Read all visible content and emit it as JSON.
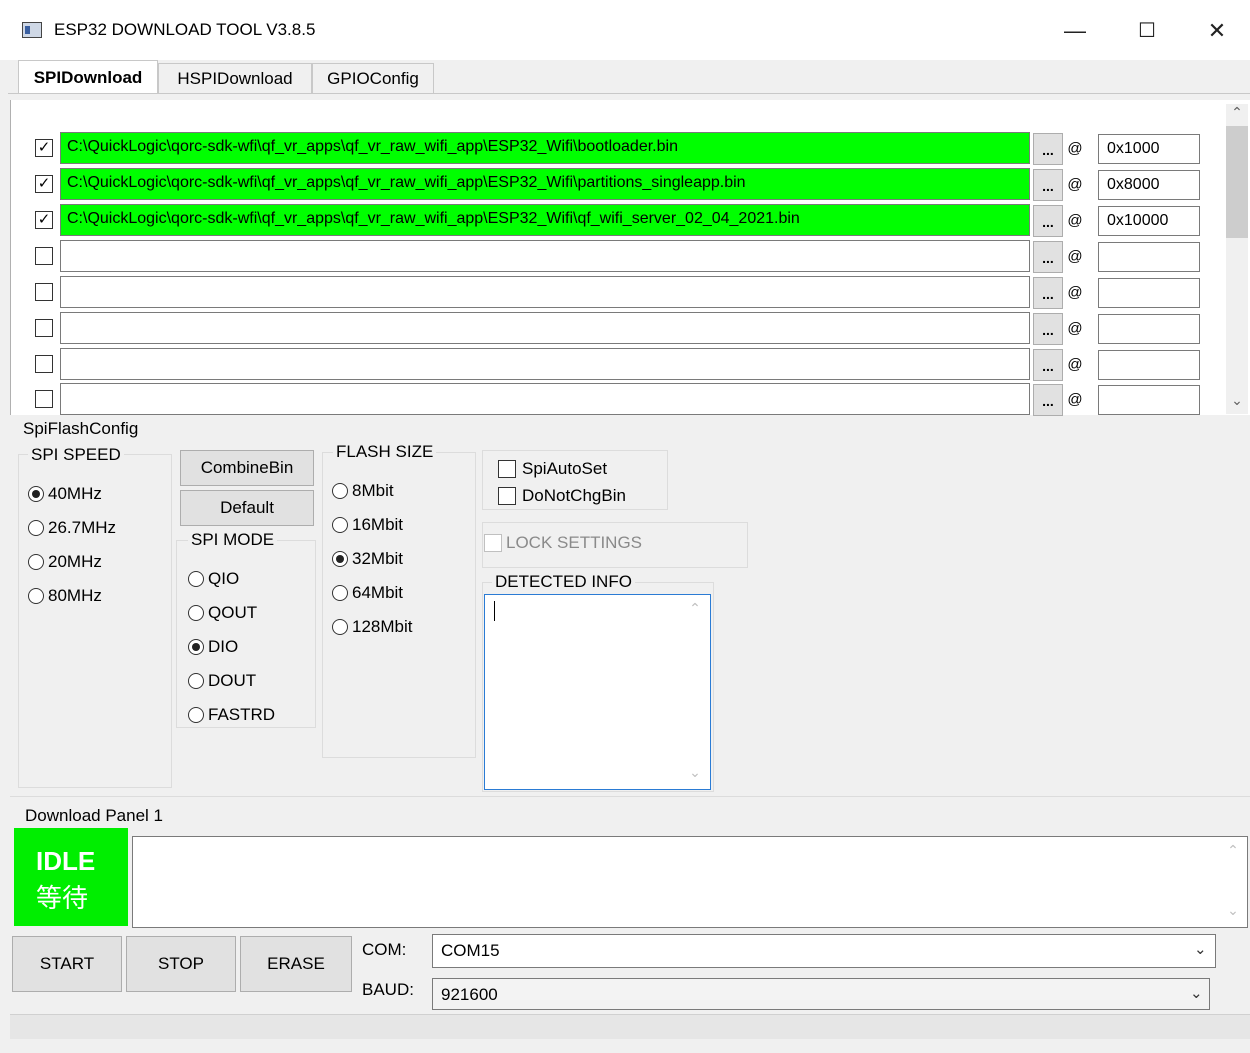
{
  "window": {
    "title": "ESP32 DOWNLOAD TOOL V3.8.5",
    "minimize": "—",
    "maximize": "☐",
    "close": "✕"
  },
  "tabs": [
    {
      "label": "SPIDownload",
      "active": true
    },
    {
      "label": "HSPIDownload",
      "active": false
    },
    {
      "label": "GPIOConfig",
      "active": false
    }
  ],
  "files": [
    {
      "checked": true,
      "path": "C:\\QuickLogic\\qorc-sdk-wfi\\qf_vr_apps\\qf_vr_raw_wifi_app\\ESP32_Wifi\\bootloader.bin",
      "address": "0x1000"
    },
    {
      "checked": true,
      "path": "C:\\QuickLogic\\qorc-sdk-wfi\\qf_vr_apps\\qf_vr_raw_wifi_app\\ESP32_Wifi\\partitions_singleapp.bin",
      "address": "0x8000"
    },
    {
      "checked": true,
      "path": "C:\\QuickLogic\\qorc-sdk-wfi\\qf_vr_apps\\qf_vr_raw_wifi_app\\ESP32_Wifi\\qf_wifi_server_02_04_2021.bin",
      "address": "0x10000"
    },
    {
      "checked": false,
      "path": "",
      "address": ""
    },
    {
      "checked": false,
      "path": "",
      "address": ""
    },
    {
      "checked": false,
      "path": "",
      "address": ""
    },
    {
      "checked": false,
      "path": "",
      "address": ""
    },
    {
      "checked": false,
      "path": "",
      "address": ""
    }
  ],
  "browse_label": "...",
  "at_label": "@",
  "check_glyph": "✓",
  "spi_flash_config": {
    "label": "SpiFlashConfig",
    "spi_speed": {
      "label": "SPI SPEED",
      "options": [
        "40MHz",
        "26.7MHz",
        "20MHz",
        "80MHz"
      ],
      "selected": 0
    },
    "combine_bin": "CombineBin",
    "default": "Default",
    "spi_mode": {
      "label": "SPI MODE",
      "options": [
        "QIO",
        "QOUT",
        "DIO",
        "DOUT",
        "FASTRD"
      ],
      "selected": 2
    },
    "flash_size": {
      "label": "FLASH SIZE",
      "options": [
        "8Mbit",
        "16Mbit",
        "32Mbit",
        "64Mbit",
        "128Mbit"
      ],
      "selected": 2
    },
    "spi_auto_set": "SpiAutoSet",
    "do_not_chg_bin": "DoNotChgBin",
    "lock_settings": "LOCK SETTINGS",
    "detected_info": "DETECTED INFO"
  },
  "download_panel": {
    "label": "Download Panel 1",
    "status_en": "IDLE",
    "status_cn": "等待",
    "status_color": "#00ee00",
    "start": "START",
    "stop": "STOP",
    "erase": "ERASE",
    "com_label": "COM:",
    "com_value": "COM15",
    "baud_label": "BAUD:",
    "baud_value": "921600"
  }
}
